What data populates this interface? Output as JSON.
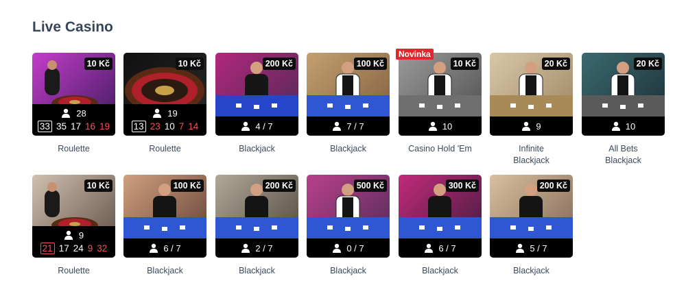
{
  "section": {
    "title": "Live Casino"
  },
  "colors": {
    "red_number": "#f4535a",
    "new_badge": "#e3262e",
    "bar_bg": "#000000"
  },
  "games": [
    {
      "name": "Roulette",
      "limit": "10 Kč",
      "players": "28",
      "kind": "roulette",
      "numbers": [
        {
          "v": "33",
          "c": "white",
          "boxed": true
        },
        {
          "v": "35",
          "c": "white"
        },
        {
          "v": "17",
          "c": "white"
        },
        {
          "v": "16",
          "c": "red"
        },
        {
          "v": "19",
          "c": "red"
        }
      ]
    },
    {
      "name": "Roulette",
      "limit": "10 Kč",
      "players": "19",
      "kind": "roulette",
      "numbers": [
        {
          "v": "13",
          "c": "white",
          "boxed": true
        },
        {
          "v": "23",
          "c": "red"
        },
        {
          "v": "10",
          "c": "white"
        },
        {
          "v": "7",
          "c": "red"
        },
        {
          "v": "14",
          "c": "red"
        }
      ]
    },
    {
      "name": "Blackjack",
      "limit": "200 Kč",
      "players": "4 / 7",
      "kind": "table"
    },
    {
      "name": "Blackjack",
      "limit": "100 Kč",
      "players": "7 / 7",
      "kind": "table"
    },
    {
      "name": "Casino Hold 'Em",
      "limit": "10 Kč",
      "players": "10",
      "kind": "table",
      "badge": "Novinka"
    },
    {
      "name": "Infinite Blackjack",
      "limit": "20 Kč",
      "players": "9",
      "kind": "table"
    },
    {
      "name": "All Bets Blackjack",
      "limit": "20 Kč",
      "players": "10",
      "kind": "table"
    },
    {
      "name": "Roulette",
      "limit": "10 Kč",
      "players": "9",
      "kind": "roulette",
      "numbers": [
        {
          "v": "21",
          "c": "red",
          "boxed": true
        },
        {
          "v": "17",
          "c": "white"
        },
        {
          "v": "24",
          "c": "white"
        },
        {
          "v": "9",
          "c": "red"
        },
        {
          "v": "32",
          "c": "red"
        }
      ]
    },
    {
      "name": "Blackjack",
      "limit": "100 Kč",
      "players": "6 / 7",
      "kind": "table"
    },
    {
      "name": "Blackjack",
      "limit": "200 Kč",
      "players": "2 / 7",
      "kind": "table"
    },
    {
      "name": "Blackjack",
      "limit": "500 Kč",
      "players": "0 / 7",
      "kind": "table"
    },
    {
      "name": "Blackjack",
      "limit": "300 Kč",
      "players": "6 / 7",
      "kind": "table"
    },
    {
      "name": "Blackjack",
      "limit": "200 Kč",
      "players": "5 / 7",
      "kind": "table"
    }
  ]
}
